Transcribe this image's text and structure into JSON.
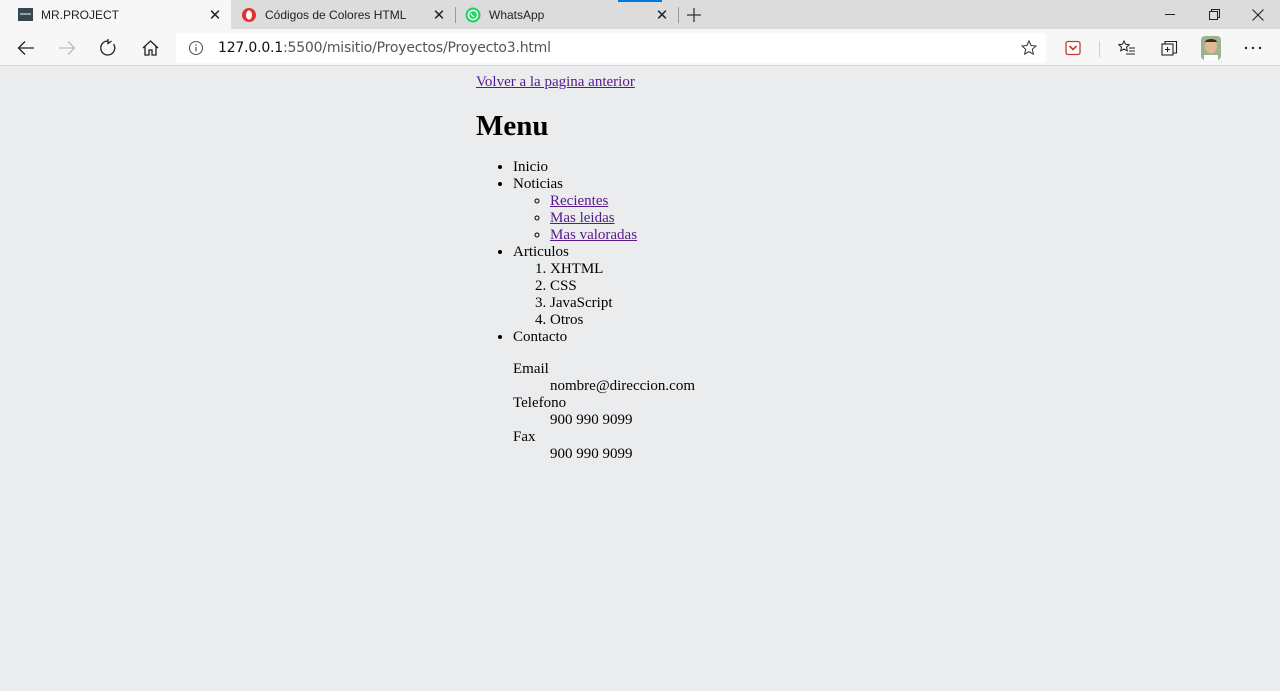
{
  "browser": {
    "tabs": [
      {
        "title": "MR.PROJECT",
        "active": true,
        "icon": "project-favicon"
      },
      {
        "title": "Códigos de Colores HTML",
        "active": false,
        "icon": "opera-favicon"
      },
      {
        "title": "WhatsApp",
        "active": false,
        "icon": "whatsapp-favicon"
      }
    ],
    "address": {
      "host": "127.0.0.1",
      "path": ":5500/misitio/Proyectos/Proyecto3.html"
    },
    "colors": {
      "tabstrip": "#dcdcdc",
      "toolbar": "#f7f7f7",
      "accent": "#0078d7",
      "page_bg": "#ebecee",
      "link": "#551a8b"
    }
  },
  "page": {
    "back_link": "Volver a la pagina anterior",
    "heading": "Menu",
    "menu": {
      "inicio": "Inicio",
      "noticias": "Noticias",
      "noticias_items": [
        "Recientes",
        "Mas leidas",
        "Mas valoradas"
      ],
      "articulos": "Articulos",
      "articulos_items": [
        "XHTML",
        "CSS",
        "JavaScript",
        "Otros"
      ],
      "contacto": "Contacto"
    },
    "contact": [
      {
        "term": "Email",
        "value": "nombre@direccion.com"
      },
      {
        "term": "Telefono",
        "value": "900 990 9099"
      },
      {
        "term": "Fax",
        "value": "900 990 9099"
      }
    ]
  }
}
